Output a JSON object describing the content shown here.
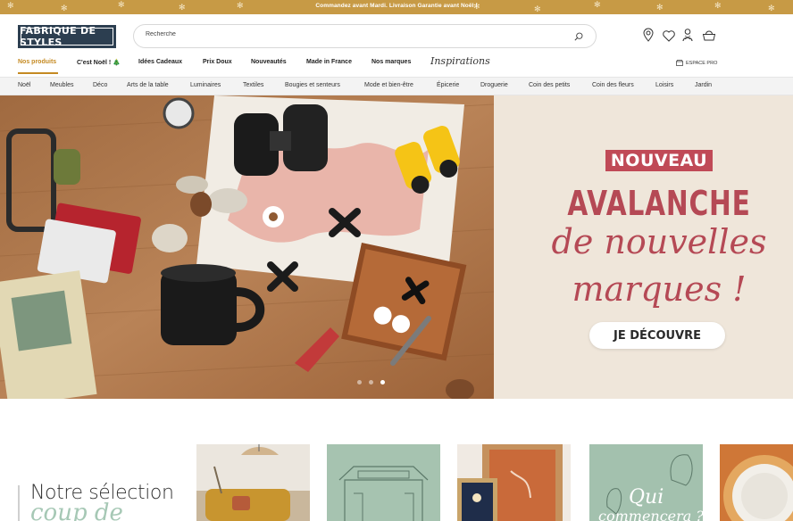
{
  "promo": {
    "text": "Commandez avant Mardi. Livraison Garantie avant Noël !"
  },
  "header": {
    "logo_text": "FABRIQUE DE STYLES",
    "search_placeholder": "Recherche"
  },
  "icons": {
    "search": "search-icon",
    "store": "store-locator-icon",
    "wishlist": "heart-icon",
    "account": "account-icon",
    "cart": "basket-icon",
    "pro": "shop-icon"
  },
  "nav": {
    "primary": [
      "Nos produits",
      "C'est Noël ! 🎄",
      "Idées Cadeaux",
      "Prix Doux",
      "Nouveautés",
      "Made in France",
      "Nos marques"
    ],
    "inspirations": "Inspirations",
    "pro_label": "ESPACE PRO",
    "active_color": "#c58a22",
    "categories": [
      "Noël",
      "Meubles",
      "Déco",
      "Arts de la table",
      "Luminaires",
      "Textiles",
      "Bougies et senteurs",
      "Mode et bien-être",
      "Épicerie",
      "Droguerie",
      "Coin des petits",
      "Coin des fleurs",
      "Loisirs",
      "Jardin"
    ]
  },
  "hero": {
    "badge": "NOUVEAU",
    "headline": "AVALANCHE",
    "script_line1": "de nouvelles",
    "script_line2": "marques !",
    "cta": "JE DÉCOUVRE",
    "accent_color": "#b54955",
    "slide_count": 3,
    "active_slide": 3
  },
  "selection": {
    "title": "Notre sélection",
    "script": "coup de"
  },
  "colors": {
    "promo_bg": "#c79a45",
    "logo_bg": "#2c3e50",
    "hero_bg": "#efe6da"
  }
}
